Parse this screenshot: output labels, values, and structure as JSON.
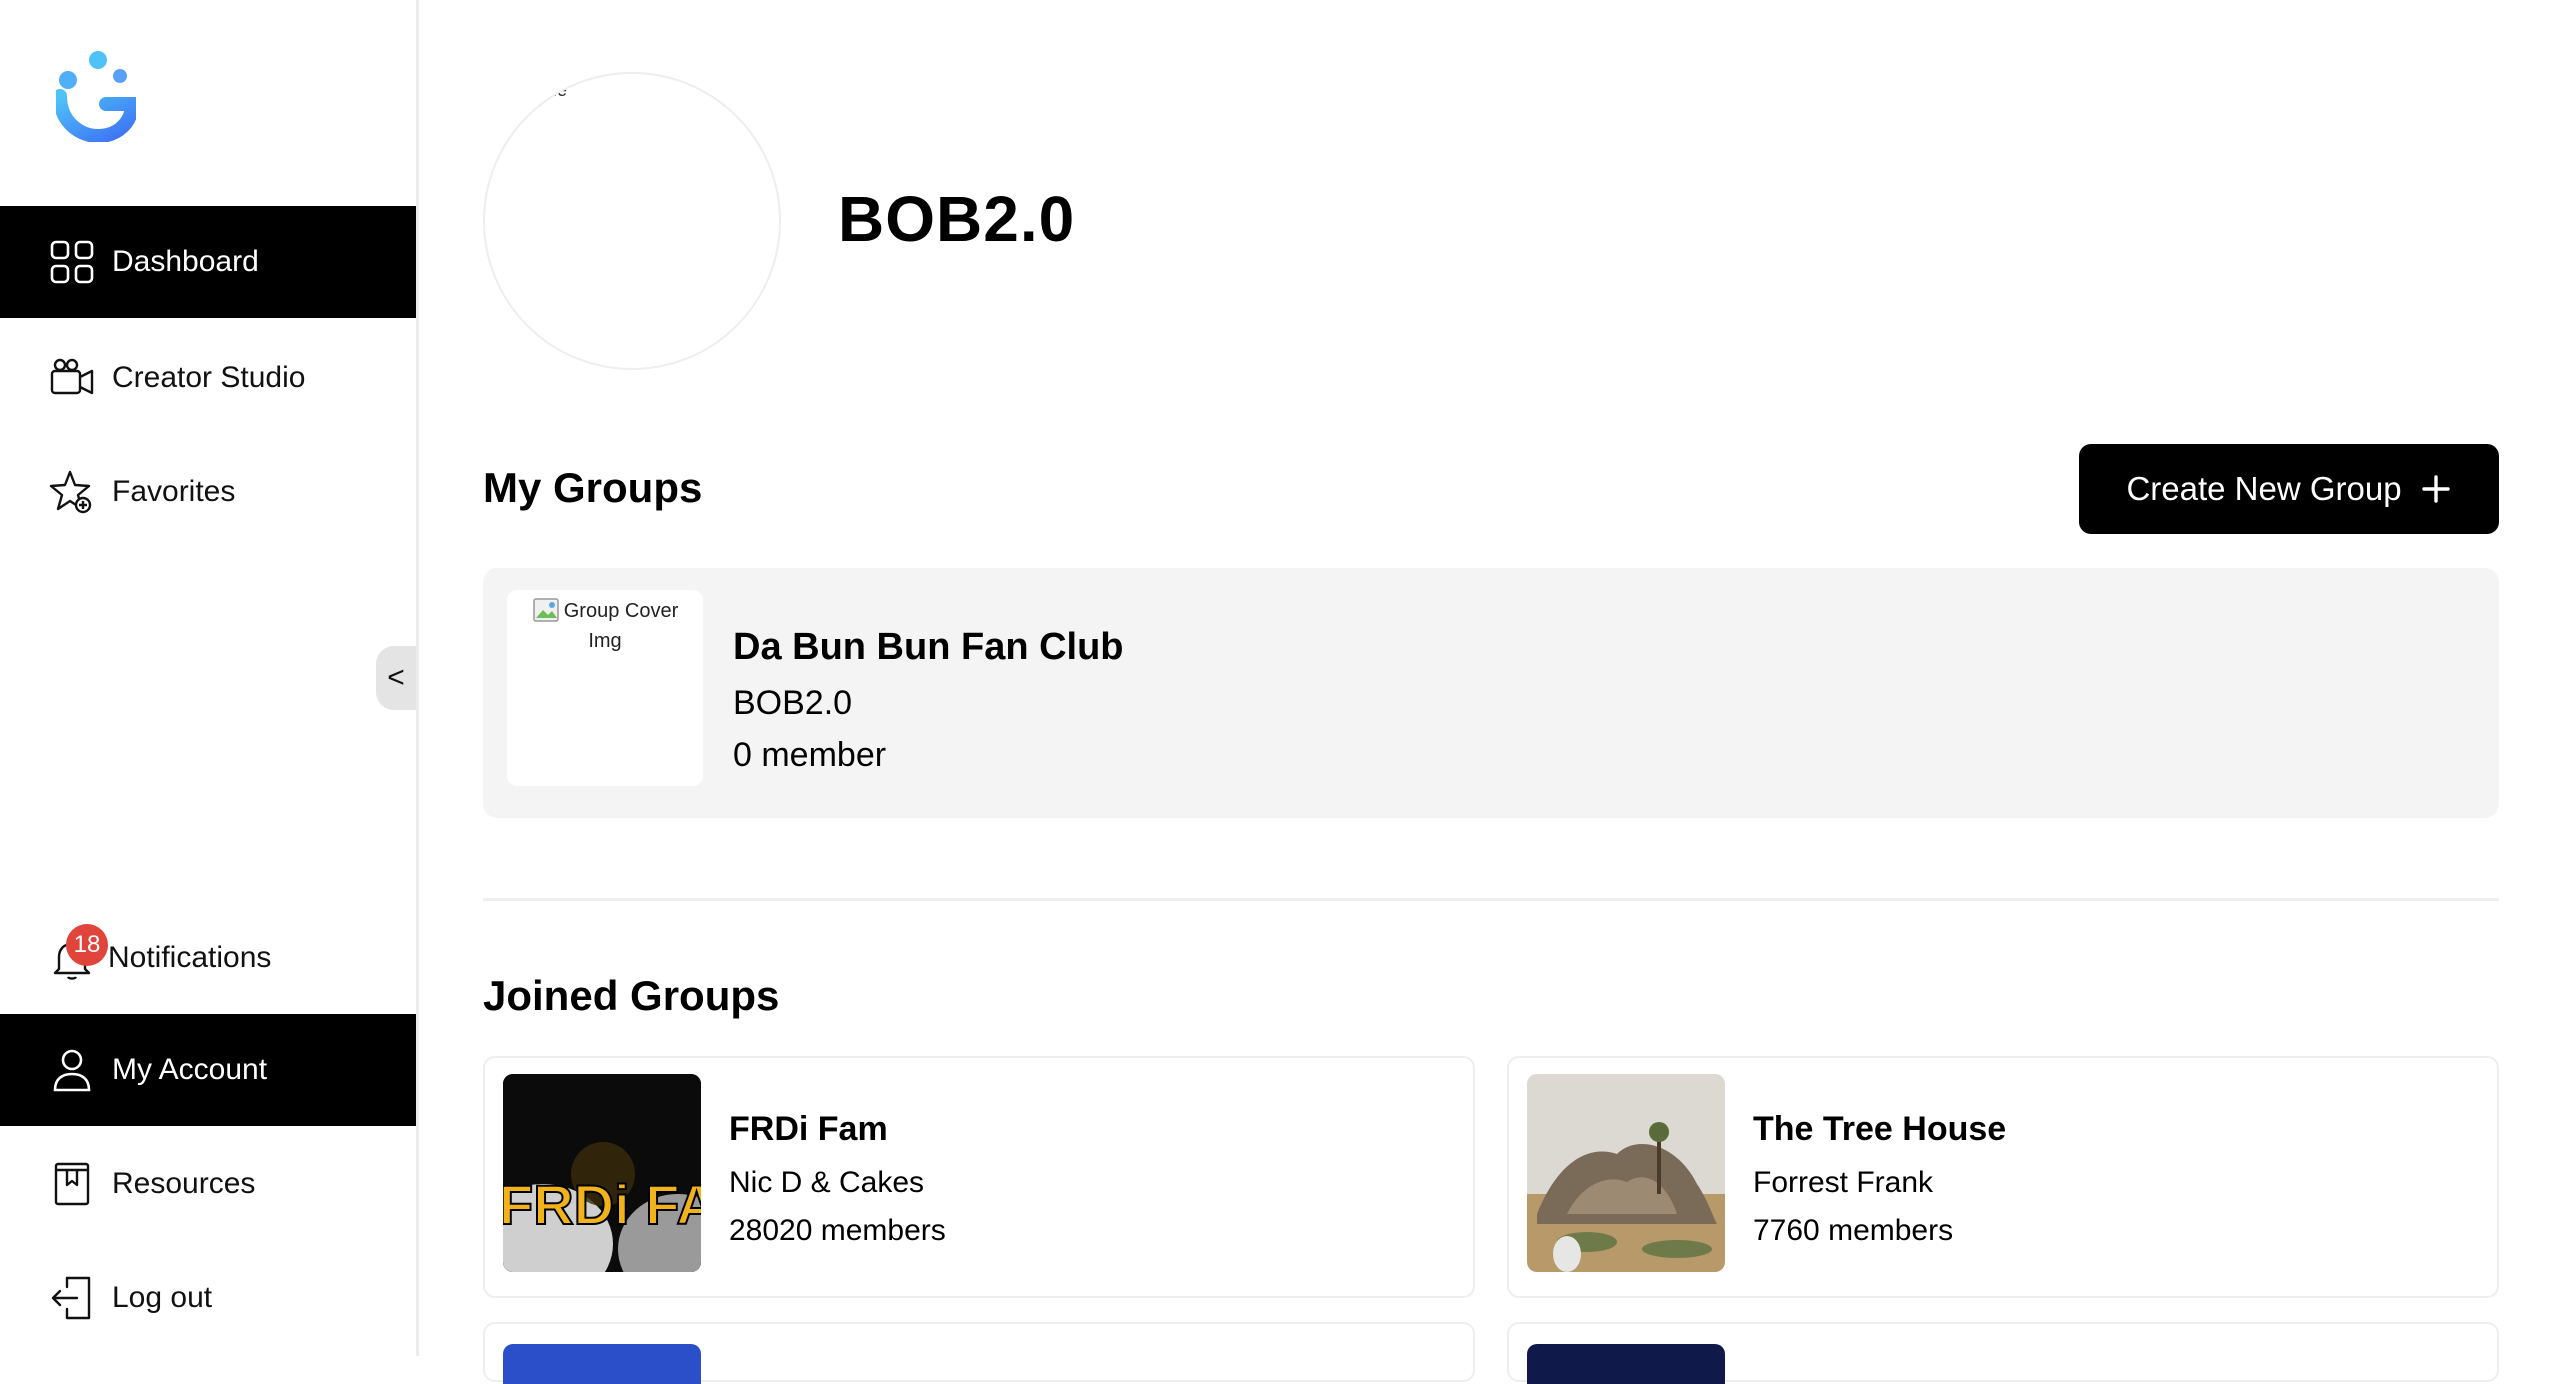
{
  "sidebar": {
    "items": [
      {
        "label": "Dashboard",
        "icon": "grid-icon",
        "active": true
      },
      {
        "label": "Creator Studio",
        "icon": "video-camera-icon",
        "active": false
      },
      {
        "label": "Favorites",
        "icon": "star-icon",
        "active": false
      }
    ],
    "bottom_items": [
      {
        "label": "Notifications",
        "icon": "bell-icon",
        "active": false
      },
      {
        "label": "My Account",
        "icon": "user-icon",
        "active": true
      },
      {
        "label": "Resources",
        "icon": "book-icon",
        "active": false
      },
      {
        "label": "Log out",
        "icon": "logout-icon",
        "active": false
      }
    ],
    "notification_count": "18",
    "collapse_label": "<"
  },
  "profile": {
    "name": "BOB2.0",
    "avatar_alt": "ile"
  },
  "my_groups": {
    "title": "My Groups",
    "create_label": "Create New Group",
    "groups": [
      {
        "name": "Da Bun Bun Fan Club",
        "owner": "BOB2.0",
        "members": "0 member",
        "cover_alt": "Group Cover Img"
      }
    ]
  },
  "joined_groups": {
    "title": "Joined Groups",
    "groups": [
      {
        "name": "FRDi Fam",
        "owner": "Nic D & Cakes",
        "members": "28020 members",
        "thumb_text": "FRDi FAM"
      },
      {
        "name": "The Tree House",
        "owner": "Forrest Frank",
        "members": "7760 members"
      }
    ]
  },
  "colors": {
    "accent": "#000000",
    "badge": "#e0443a",
    "card_bg": "#f4f4f4",
    "logo_blue": "#3d8bf5",
    "logo_cyan": "#4fc3f7"
  }
}
